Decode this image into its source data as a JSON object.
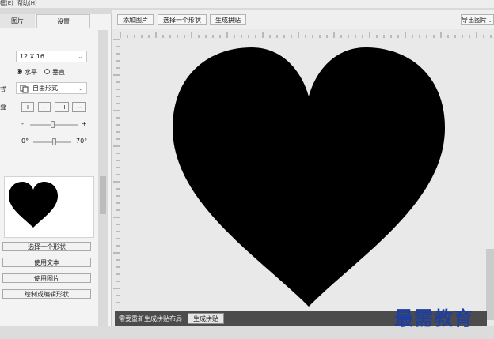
{
  "menu": {
    "item1": "框(E)",
    "item2": "帮助(H)"
  },
  "tabs": {
    "images": "图片",
    "settings": "设置"
  },
  "settings": {
    "grid_size": "12 X 16",
    "orientation_horizontal": "水平",
    "orientation_vertical": "垂直",
    "style_label": "式",
    "style_value": "自由形式",
    "stack_label": "叠",
    "stack_buttons": [
      "+",
      "-",
      "++",
      "--"
    ],
    "slider1_min": "-",
    "slider1_max": "+",
    "slider2_min": "0°",
    "slider2_max": "70°"
  },
  "shape_buttons": [
    "选择一个形状",
    "使用文本",
    "使用图片",
    "绘制或编辑形状"
  ],
  "toolbar": {
    "add_images": "添加图片",
    "select_shape": "选择一个形状",
    "generate": "生成拼贴",
    "export": "导出图片..."
  },
  "status": {
    "message": "需要重新生成拼贴布局",
    "generate_button": "生成拼贴"
  },
  "watermark": "最需教育",
  "colors": {
    "heart": "#000000",
    "canvas": "#e9e9e9",
    "statusbar": "#4c4c4c",
    "watermark": "#1f3f9f"
  }
}
